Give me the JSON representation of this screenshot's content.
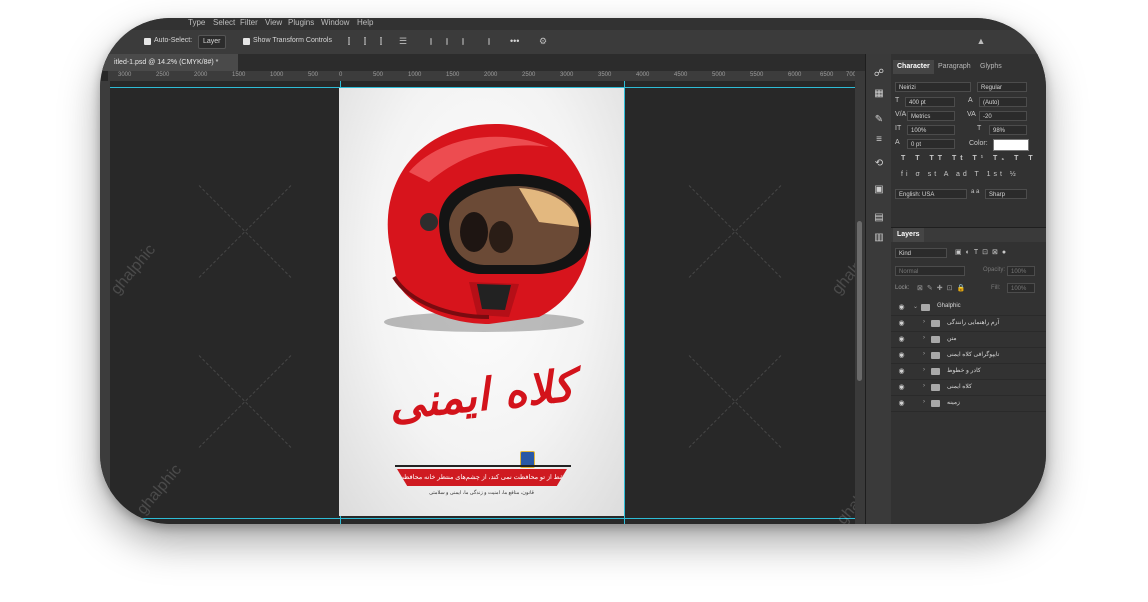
{
  "menubar": {
    "items": [
      "Type",
      "Select",
      "Filter",
      "View",
      "Plugins",
      "Window",
      "Help"
    ]
  },
  "options": {
    "auto_select_label": "Auto-Select:",
    "auto_select_value": "Layer",
    "show_transform_label": "Show Transform Controls",
    "more_label": "•••"
  },
  "document": {
    "tab_title": "itled-1.psd @ 14.2% (CMYK/8#) *"
  },
  "ruler": {
    "ticks": [
      "3000",
      "2500",
      "2000",
      "1500",
      "1000",
      "500",
      "0",
      "500",
      "1000",
      "1500",
      "2000",
      "2500",
      "3000",
      "3500",
      "4000",
      "4500",
      "5000",
      "5500",
      "6000",
      "6500",
      "7000"
    ]
  },
  "poster": {
    "headline": "کلاه ایمنی",
    "banner": "فقط از تو محافظت نمی کند، از چشم‌های منتظر خانه محافظت می‌کند.",
    "subline": "قانون، منافع ما، امنیت و زندگی ما، ایمنی و سلامتی"
  },
  "character_panel": {
    "tabs": [
      "Character",
      "Paragraph",
      "Glyphs"
    ],
    "font_family": "Neirizi",
    "font_style": "Regular",
    "font_size": "400 pt",
    "leading": "(Auto)",
    "kerning": "Metrics",
    "tracking": "-20",
    "vertical_scale": "100%",
    "horizontal_scale": "98%",
    "baseline_shift": "0 pt",
    "color_label": "Color:",
    "language": "English: USA",
    "aa_label": "a",
    "antialias": "Sharp"
  },
  "layers_panel": {
    "title": "Layers",
    "filter_kind": "Kind",
    "blend_mode": "Normal",
    "opacity_label": "Opacity:",
    "opacity_value": "100%",
    "lock_label": "Lock:",
    "fill_label": "Fill:",
    "fill_value": "100%",
    "group": "Ghalphic",
    "layers": [
      {
        "name": "آرم راهنمایی رانندگی"
      },
      {
        "name": "متن"
      },
      {
        "name": "تایپوگرافی کلاه ایمنی"
      },
      {
        "name": "کادر و خطوط"
      },
      {
        "name": "کلاه ایمنی"
      },
      {
        "name": "زمینه"
      }
    ]
  },
  "watermark": "ghalphic",
  "colors": {
    "accent_red": "#d3131b",
    "panel_bg": "#323232",
    "canvas_bg": "#282828",
    "guide": "#2ebcd6"
  }
}
